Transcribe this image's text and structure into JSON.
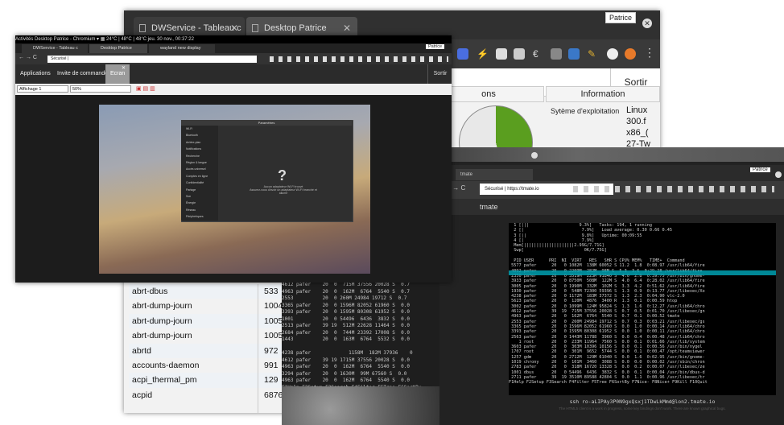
{
  "window_back": {
    "tabs": [
      {
        "label": "DWService - Tableau c"
      },
      {
        "label": "Desktop Patrice"
      }
    ],
    "user_badge": "Patrice",
    "sortir": "Sortir",
    "panels": {
      "partial_left": "ons",
      "information": "Information"
    },
    "info_label": "Sytème d'exploitation",
    "info_values": [
      "Linux",
      "300.f",
      "x86_(",
      "27-Tw"
    ],
    "processes": [
      {
        "name": "abrt-dbus",
        "pid": "533"
      },
      {
        "name": "abrt-dump-journ",
        "pid": "1004"
      },
      {
        "name": "abrt-dump-journ",
        "pid": "1005"
      },
      {
        "name": "abrt-dump-journ",
        "pid": "1005"
      },
      {
        "name": "abrtd",
        "pid": "972"
      },
      {
        "name": "accounts-daemon",
        "pid": "991"
      },
      {
        "name": "acpi_thermal_pm",
        "pid": "129"
      },
      {
        "name": "acpid",
        "pid": "6876"
      }
    ],
    "htop_text": "4612 pafer    20  0  715M 37556 20028 S  0.7\n4963 pafer    20  0  162M  6764  5540 S  0.7\n2553          20  0 260M 24984 19712 S  0.7\n3365 pafer    20  0 1596M 82052 61960 S  0.0\n3393 pafer    20  0 1595M 80308 61952 S  0.0\n1001          20  0 54496  6436  3832 S  0.0\n2513 pafer    39 19  512M 22628 11464 S  0.0\n2684 pafer    20  0  744M 23392 17008 S  0.0\n1443          20  0  163M  6764  5532 S  0.0\n\n4238 pafer             1158M  182M 37936    0\n4612 pafer    39 19 1715M 37556 20028 S  0.0\n4963 pafer    20  0  162M  6764  5540 S  0.0\n3294 pafer    20  0 1630M  99M 67560 S  0.0\n4963 pafer    20  0  162M  6764  5540 S  0.0\nF1Help F2Setup F3Search F4Filter F5Tree F6SortBy\n[0] 0:htop*"
  },
  "window_tmate": {
    "tab_label": "tmate",
    "url": "Sécurisé | https://tmate.io",
    "user_badge": "Patrice",
    "app_title": "tmate",
    "terminal": "  1 [|||                    9.3%]   Tasks: 194, 1 running\n  2 [|                       7.9%]   Load average: 0.30 0.66 0.45\n  3 [||                      9.8%]   Uptime: 00:09:55\n  4 [|                       7.9%]\n  Mem[||||||||||||||||||||2.99G/7.71G]\n  Swp[                        0K/7.75G]\n\n  PID USER      PRI  NI  VIRT   RES   SHR S CPU% MEM%   TIME+  Command\n 5577 pafer      20   0 1082M  138M 60052 S 11.2  1.8  0:08.97 /usr/lib64/fire\n 4092 pafer      20   0 2209M  282M  98M S  5.3  3.6  0:29.28 /usr/lib64/fire\n 2350 pafer      20   0 3519M  223M 91840 S  4.0  2.8  0:39.75 /usr/bin/gnome-\n 3933 pafer      20   0 8750M  508M  122M S  4.0  6.4  0:28.02 /usr/lib64/fire\n 3005 pafer      20   0 1990M  332M  102M S  3.3  4.2  0:51.62 /usr/lib64/fire\n 1930 pafer      20   0  548M 72300 59396 S  1.3  0.9  0:13.77 /usr/libexec/Xo\n 4238 pafer      20   0 1172M  183M 37372 S  1.3  2.3  0:04.90 vlc-2.0\n 5623 pafer      20   0  120M  4876  3400 R  1.3  0.1  0:00.59 htop\n 3002 pafer      20   0 1099M  124M 95824 S  1.3  1.6  0:12.27 /usr/lib64/chro\n 4612 pafer      39  19  715M 37556 20028 S  0.7  0.5  0:01.70 /usr/libexec/gn\n 4963 pafer      20   0  162M  6764  5540 S  0.7  0.1  0:00.52 tmate\n 2553 pafer      20   0  260M 24984 19712 S  0.7  0.3  0:03.21 /usr/libexec/gs\n 3365 pafer      20   0 1596M 82052 61960 S  0.0  1.0  0:00.14 /usr/lib64/chro\n 3393 pafer      20   0 1595M 80308 61952 S  0.0  1.0  0:00.11 /usr/lib64/chro\n 2563 pafer      20   0 1443M 11788  3960 S  0.0  0.4  0:00.48 /usr/lib64/chro\n    1 root       20   0  233M 11964  7560 S  0.0  0.1  0:01.66 /usr/lib/system\n 3603 pafer      20   0  303M 10396 10156 S  0.0  0.1  0:00.56 /usr/bin/nygel\n 1707 root       20   0  301M  9652  5744 S  0.0  0.1  0:00.47 /opt/teamviewer\n 1257 gdm        20   0 2712M  129M 61040 S  0.0  1.6  0:02.95 /usr/bin/gnome-\n 1019 chrony     20   0  101M  3460  3088 S  0.0  0.0  0:00.02 /usr/sbin/chron\n 2783 pafer      20   0  318M 16720 13328 S  0.0  0.2  0:00.07 /usr/libexec/ze\n 1001 dbus       20   0 54496  6436  3832 S  0.0  0.1  0:00.04 /usr/bin/dbus-d\n 2711 pafer      39  19 3510M 89588 42804 S  0.0  1.1  0:00.96 /usr/libexec/tr\nF1Help F2Setup F3Search F4Filter F5Tree F6SortBy F7Nice- F8Nice+ F9Kill F10Quit",
    "ssh_line": "ssh ro-aLIPAy3P0N9gxQsxj1TDwLkMmd@lon2.tmate.io",
    "sub_line": "The HTML5 client is a work in progress, some key bindings don't work. There are known graphical bugs."
  },
  "window_front": {
    "gnome_bar": "Activités   Desktop Patrice - Chromium ▾    ▦ 24°C | 48°C | 48°C                 jeu. 30 nov., 00:37:22",
    "tabs": [
      {
        "label": "DWService - Tableau c"
      },
      {
        "label": "Desktop Patrice"
      },
      {
        "label": "wayland new display"
      }
    ],
    "user_badge": "Patrice",
    "url": "Sécurisé |",
    "app_tabs": [
      {
        "label": "Applications",
        "active": false
      },
      {
        "label": "Invite de commande",
        "active": false
      },
      {
        "label": "Ecran",
        "active": true
      }
    ],
    "sortir": "Sortir",
    "display_select": "Affichage 1",
    "zoom_select": "50%",
    "dialog": {
      "title": "Paramètres",
      "sidebar": [
        "Wi-Fi",
        "Bluetooth",
        "Arrière-plan",
        "Notifications",
        "Recherche",
        "Région & langue",
        "Accès universel",
        "Comptes en ligne",
        "Confidentialité",
        "Partage",
        "Son",
        "Énergie",
        "Réseau",
        "Périphériques"
      ],
      "message": "Aucun adaptateur Wi-Fi trouvé",
      "submessage": "Assurez-vous d'avoir un adaptateur Wi-Fi branché et allumé"
    }
  },
  "colors": {
    "pie_green": "#5a9e1f",
    "htop_selected": "#00a0b0",
    "htop_fkey": "#00a0b0"
  }
}
